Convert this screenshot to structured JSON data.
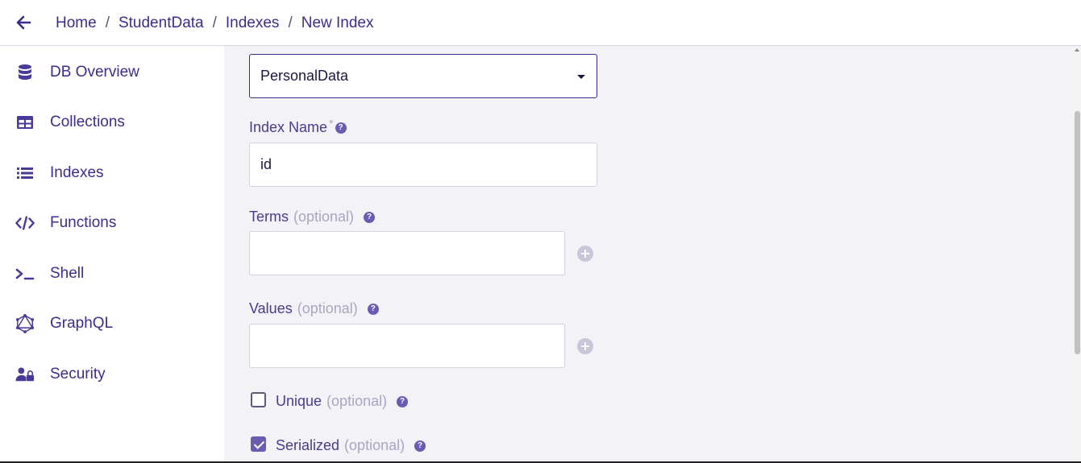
{
  "header": {
    "back_icon": "arrow-left-icon",
    "breadcrumb": [
      "Home",
      "StudentData",
      "Indexes",
      "New Index"
    ],
    "separator": "/"
  },
  "sidebar": {
    "items": [
      {
        "label": "DB Overview",
        "icon": "database-icon"
      },
      {
        "label": "Collections",
        "icon": "table-icon"
      },
      {
        "label": "Indexes",
        "icon": "list-icon"
      },
      {
        "label": "Functions",
        "icon": "code-icon"
      },
      {
        "label": "Shell",
        "icon": "terminal-icon"
      },
      {
        "label": "GraphQL",
        "icon": "graphql-icon"
      },
      {
        "label": "Security",
        "icon": "user-lock-icon"
      }
    ]
  },
  "form": {
    "source_collection": {
      "value": "PersonalData"
    },
    "index_name": {
      "label": "Index Name",
      "required_mark": "*",
      "value": "id"
    },
    "terms": {
      "label": "Terms",
      "optional": "(optional)",
      "value": ""
    },
    "values": {
      "label": "Values",
      "optional": "(optional)",
      "value": ""
    },
    "unique": {
      "label": "Unique",
      "optional": "(optional)",
      "checked": false
    },
    "serialized": {
      "label": "Serialized",
      "optional": "(optional)",
      "checked": true
    }
  },
  "colors": {
    "brand": "#3d2c8d",
    "main_bg": "#f2f2f7",
    "checkbox_checked": "#6a5bb3"
  }
}
